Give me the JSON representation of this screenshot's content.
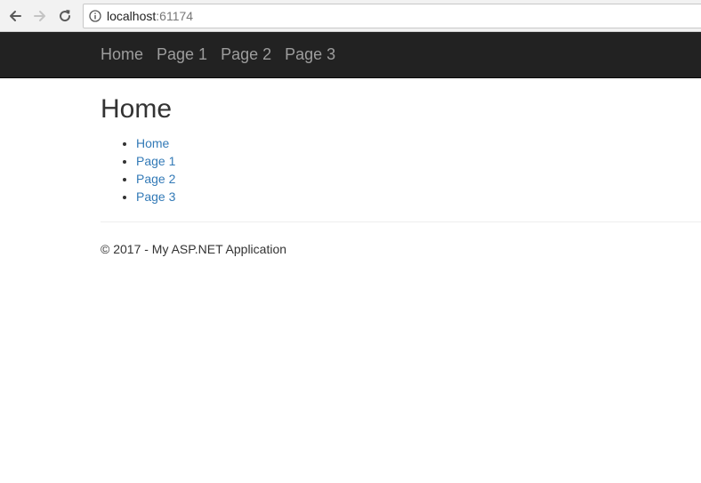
{
  "browser": {
    "back_icon": "back-arrow-icon",
    "forward_icon": "forward-arrow-icon",
    "reload_icon": "reload-icon",
    "info_icon": "info-icon",
    "url_host": "localhost",
    "url_port": ":61174"
  },
  "navbar": {
    "items": [
      {
        "label": "Home"
      },
      {
        "label": "Page 1"
      },
      {
        "label": "Page 2"
      },
      {
        "label": "Page 3"
      }
    ]
  },
  "main": {
    "title": "Home",
    "links": [
      {
        "label": "Home"
      },
      {
        "label": "Page 1"
      },
      {
        "label": "Page 2"
      },
      {
        "label": "Page 3"
      }
    ]
  },
  "footer": {
    "text": "© 2017 - My ASP.NET Application"
  },
  "colors": {
    "navbar_bg": "#222222",
    "navbar_link": "#9d9d9d",
    "link": "#337ab7",
    "text": "#333333"
  }
}
